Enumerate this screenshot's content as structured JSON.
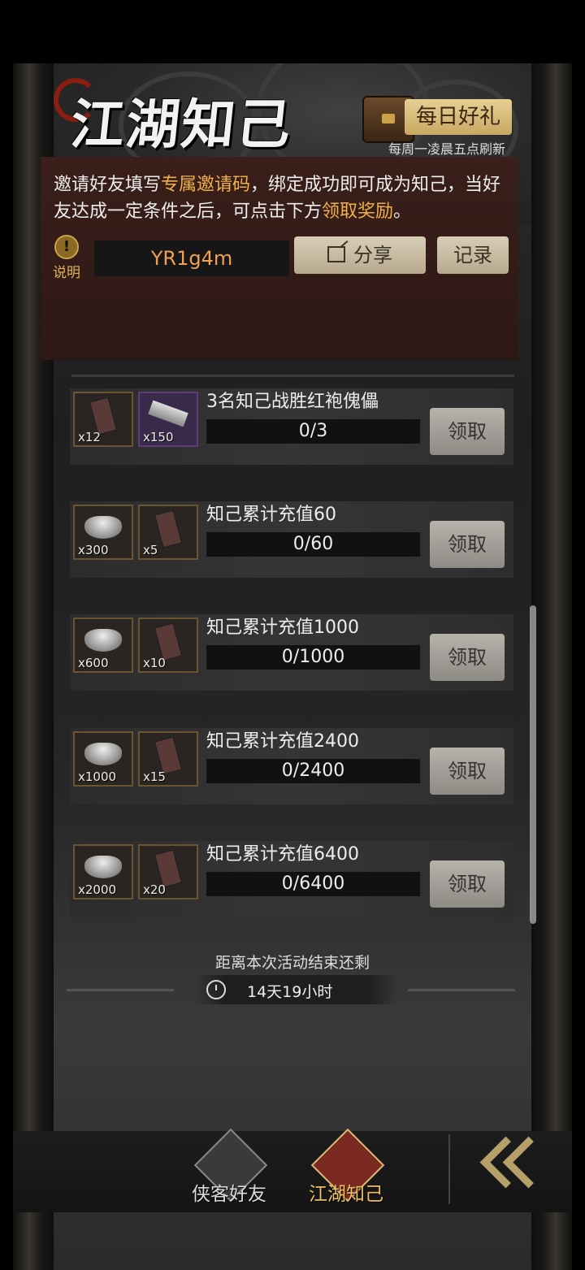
{
  "header": {
    "title": "江湖知己",
    "daily_gift_label": "每日好礼",
    "refresh_note": "每周一凌晨五点刷新"
  },
  "info": {
    "desc_part1": "邀请好友填写",
    "desc_highlight1": "专属邀请码",
    "desc_part2": "，绑定成功即可成为知己，当好友达成一定条件之后，可点击下方",
    "desc_highlight2": "领取奖励",
    "desc_part3": "。",
    "help_label": "说明",
    "invite_code": "YR1g4m",
    "share_label": "分享",
    "record_label": "记录"
  },
  "tasks": [
    {
      "title": "3名知己战胜红袍傀儡",
      "progress": "0/3",
      "claim": "领取",
      "rewards": [
        {
          "icon": "token-tag-icon",
          "count": "x12"
        },
        {
          "icon": "silver-bar-icon",
          "count": "x150"
        }
      ]
    },
    {
      "title": "知己累计充值60",
      "progress": "0/60",
      "claim": "领取",
      "rewards": [
        {
          "icon": "silver-ingot-icon",
          "count": "x300"
        },
        {
          "icon": "token-tag-icon",
          "count": "x5"
        }
      ]
    },
    {
      "title": "知己累计充值1000",
      "progress": "0/1000",
      "claim": "领取",
      "rewards": [
        {
          "icon": "silver-ingot-icon",
          "count": "x600"
        },
        {
          "icon": "token-tag-icon",
          "count": "x10"
        }
      ]
    },
    {
      "title": "知己累计充值2400",
      "progress": "0/2400",
      "claim": "领取",
      "rewards": [
        {
          "icon": "silver-ingot-icon",
          "count": "x1000"
        },
        {
          "icon": "token-tag-icon",
          "count": "x15"
        }
      ]
    },
    {
      "title": "知己累计充值6400",
      "progress": "0/6400",
      "claim": "领取",
      "rewards": [
        {
          "icon": "silver-ingot-icon",
          "count": "x2000"
        },
        {
          "icon": "token-tag-icon",
          "count": "x20"
        }
      ]
    }
  ],
  "countdown": {
    "label": "距离本次活动结束还剩",
    "value": "14天19小时"
  },
  "nav": {
    "friends_label": "侠客好友",
    "jianghu_label": "江湖知己"
  },
  "colors": {
    "highlight": "#f0b04a",
    "invite_code": "#f0a050",
    "panel_bg": "#3a1f1a"
  }
}
